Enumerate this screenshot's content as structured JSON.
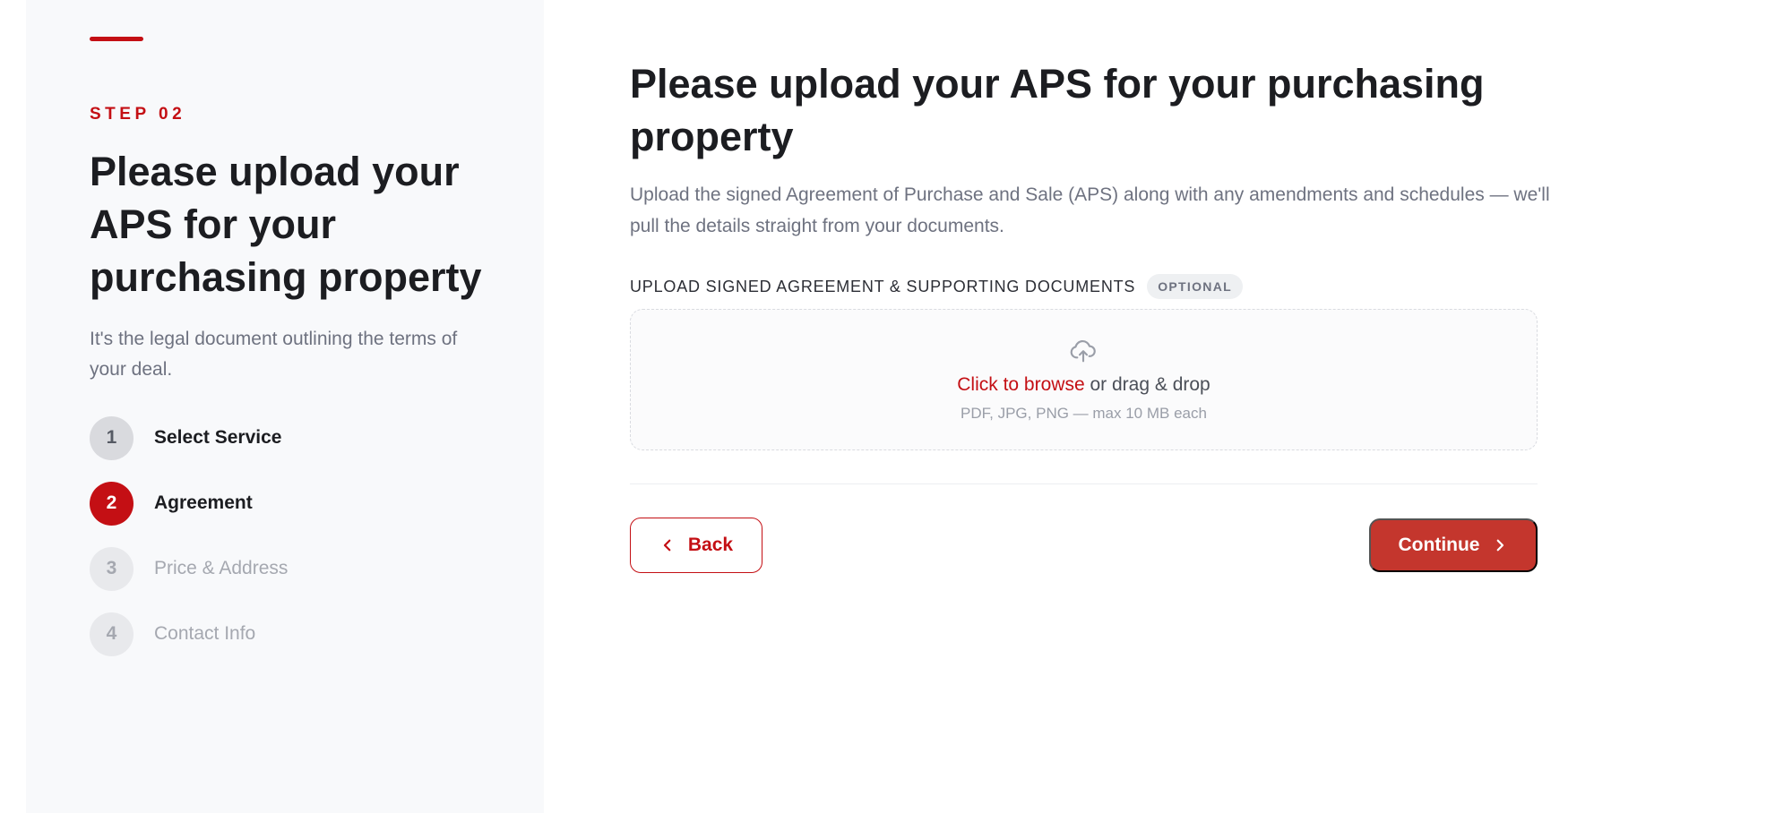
{
  "sidebar": {
    "step_label": "STEP 02",
    "title": "Please upload your APS for your purchasing property",
    "description": "It's the legal document outlining the terms of your deal.",
    "steps": [
      {
        "number": "1",
        "label": "Select Service",
        "state": "completed"
      },
      {
        "number": "2",
        "label": "Agreement",
        "state": "active"
      },
      {
        "number": "3",
        "label": "Price & Address",
        "state": "upcoming"
      },
      {
        "number": "4",
        "label": "Contact Info",
        "state": "upcoming"
      }
    ]
  },
  "main": {
    "title": "Please upload your APS for your purchasing property",
    "description": "Upload the signed Agreement of Purchase and Sale (APS) along with any amendments and schedules — we'll pull the details straight from your documents.",
    "upload": {
      "label": "UPLOAD SIGNED AGREEMENT & SUPPORTING DOCUMENTS",
      "badge": "OPTIONAL",
      "icon": "cloud-upload-icon",
      "browse_text": "Click to browse",
      "drop_text": " or drag & drop",
      "hint": "PDF, JPG, PNG — max 10 MB each"
    },
    "actions": {
      "back_label": "Back",
      "continue_label": "Continue"
    }
  },
  "colors": {
    "accent": "#c40f14",
    "continue_button": "#c4362d",
    "sidebar_background": "#f8f9fb"
  }
}
